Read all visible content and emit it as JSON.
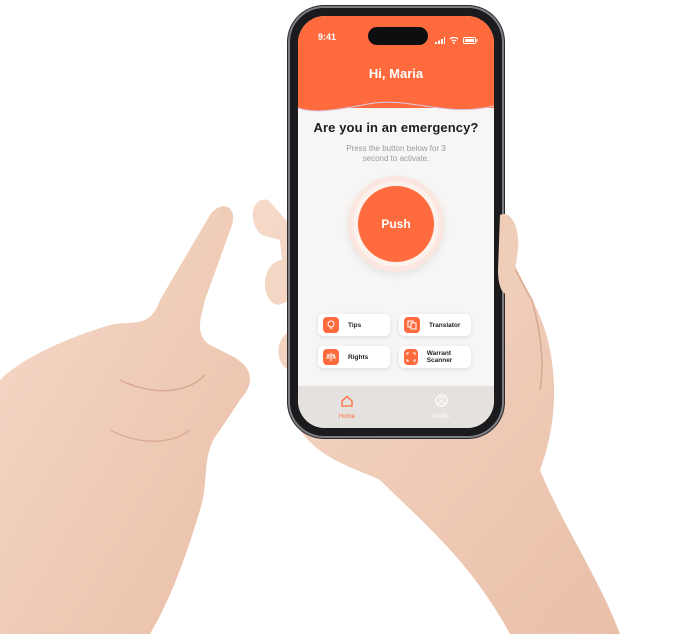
{
  "status": {
    "time": "9:41",
    "icons": [
      "signal-icon",
      "wifi-icon",
      "battery-icon"
    ]
  },
  "header": {
    "greeting": "Hi, Maria"
  },
  "main": {
    "question": "Are you in an emergency?",
    "subtext": "Press the button below for 3 second to activate.",
    "push_label": "Push"
  },
  "actions": [
    {
      "label": "Tips",
      "icon": "lightbulb-icon"
    },
    {
      "label": "Translator",
      "icon": "translate-icon"
    },
    {
      "label": "Rights",
      "icon": "scales-icon"
    },
    {
      "label": "Warrant Scanner",
      "icon": "scan-icon"
    }
  ],
  "tabs": [
    {
      "label": "Home",
      "icon": "home-icon",
      "active": true
    },
    {
      "label": "Profile",
      "icon": "profile-icon",
      "active": false
    }
  ],
  "colors": {
    "accent": "#ff6b3d",
    "tab_inactive": "#ffffff",
    "text": "#1d1d1f"
  }
}
